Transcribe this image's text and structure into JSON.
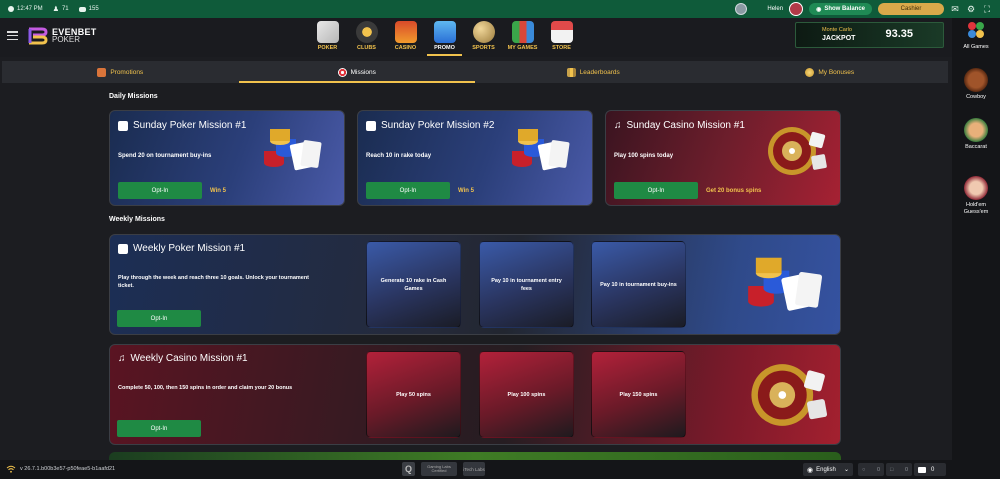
{
  "status": {
    "time": "12:47 PM",
    "players": "71",
    "tables": "155"
  },
  "user": {
    "name": "Helen",
    "show_balance": "Show Balance",
    "cashier": "Cashier"
  },
  "logo": {
    "line1": "EVENBET",
    "line2": "POKER"
  },
  "nav": [
    {
      "label": "POKER",
      "icon": "poker-cards-icon"
    },
    {
      "label": "CLUBS",
      "icon": "clubs-badge-icon"
    },
    {
      "label": "CASINO",
      "icon": "slot-machine-icon"
    },
    {
      "label": "PROMO",
      "icon": "gift-box-icon",
      "active": true
    },
    {
      "label": "SPORTS",
      "icon": "ball-icon"
    },
    {
      "label": "MY GAMES",
      "icon": "chart-bars-icon"
    },
    {
      "label": "STORE",
      "icon": "store-icon"
    }
  ],
  "jackpot": {
    "title": "Monte Carlo",
    "label": "JACKPOT",
    "value": "93.35"
  },
  "tabs": [
    {
      "label": "Promotions",
      "icon": "gift-icon"
    },
    {
      "label": "Missions",
      "icon": "target-icon",
      "active": true
    },
    {
      "label": "Leaderboards",
      "icon": "leaderboard-icon"
    },
    {
      "label": "My Bonuses",
      "icon": "coin-icon"
    }
  ],
  "daily": {
    "title": "Daily Missions",
    "cards": [
      {
        "title": "Sunday Poker Mission #1",
        "desc": "Spend 20 on tournament buy-ins",
        "optin": "Opt-In",
        "reward": "Win 5",
        "type": "poker"
      },
      {
        "title": "Sunday Poker Mission #2",
        "desc": "Reach 10 in rake today",
        "optin": "Opt-In",
        "reward": "Win 5",
        "type": "poker"
      },
      {
        "title": "Sunday Casino Mission #1",
        "desc": "Play 100 spins today",
        "optin": "Opt-In",
        "reward": "Get 20 bonus spins",
        "type": "casino"
      }
    ]
  },
  "weekly": {
    "title": "Weekly Missions",
    "poker": {
      "title": "Weekly Poker Mission #1",
      "desc": "Play through the week and reach three 10 goals. Unlock your tournament ticket.",
      "optin": "Opt-In",
      "steps": [
        "Generate 10 rake in Cash Games",
        "Pay 10 in tournament entry fees",
        "Pay 10 in tournament buy-ins"
      ]
    },
    "casino": {
      "title": "Weekly Casino Mission #1",
      "desc": "Complete 50, 100, then 150 spins in order and claim your 20 bonus",
      "optin": "Opt-In",
      "steps": [
        "Play 50 spins",
        "Play 100 spins",
        "Play 150 spins"
      ]
    }
  },
  "rail": [
    {
      "label": "All Games",
      "icon": "all-games-suits-icon"
    },
    {
      "label": "Cowboy",
      "icon": "cowboy-bull-icon"
    },
    {
      "label": "Baccarat",
      "icon": "baccarat-character-icon"
    },
    {
      "label": "Hold'em Guess'em",
      "icon": "holdem-guessem-icon"
    }
  ],
  "footer": {
    "version": "v 26.7.1.b00b3e57-p50feae5-b1aafd21",
    "badge_q": "Q",
    "badge_gaming": "Gaming Labs Certified",
    "badge_itech": "iTech Labs",
    "language": "English",
    "count1": "0",
    "count2": "0",
    "chat_count": "0"
  },
  "colors": {
    "accent": "#f1c24d",
    "green": "#1f8a44",
    "statusbar": "#0f5b3a"
  }
}
